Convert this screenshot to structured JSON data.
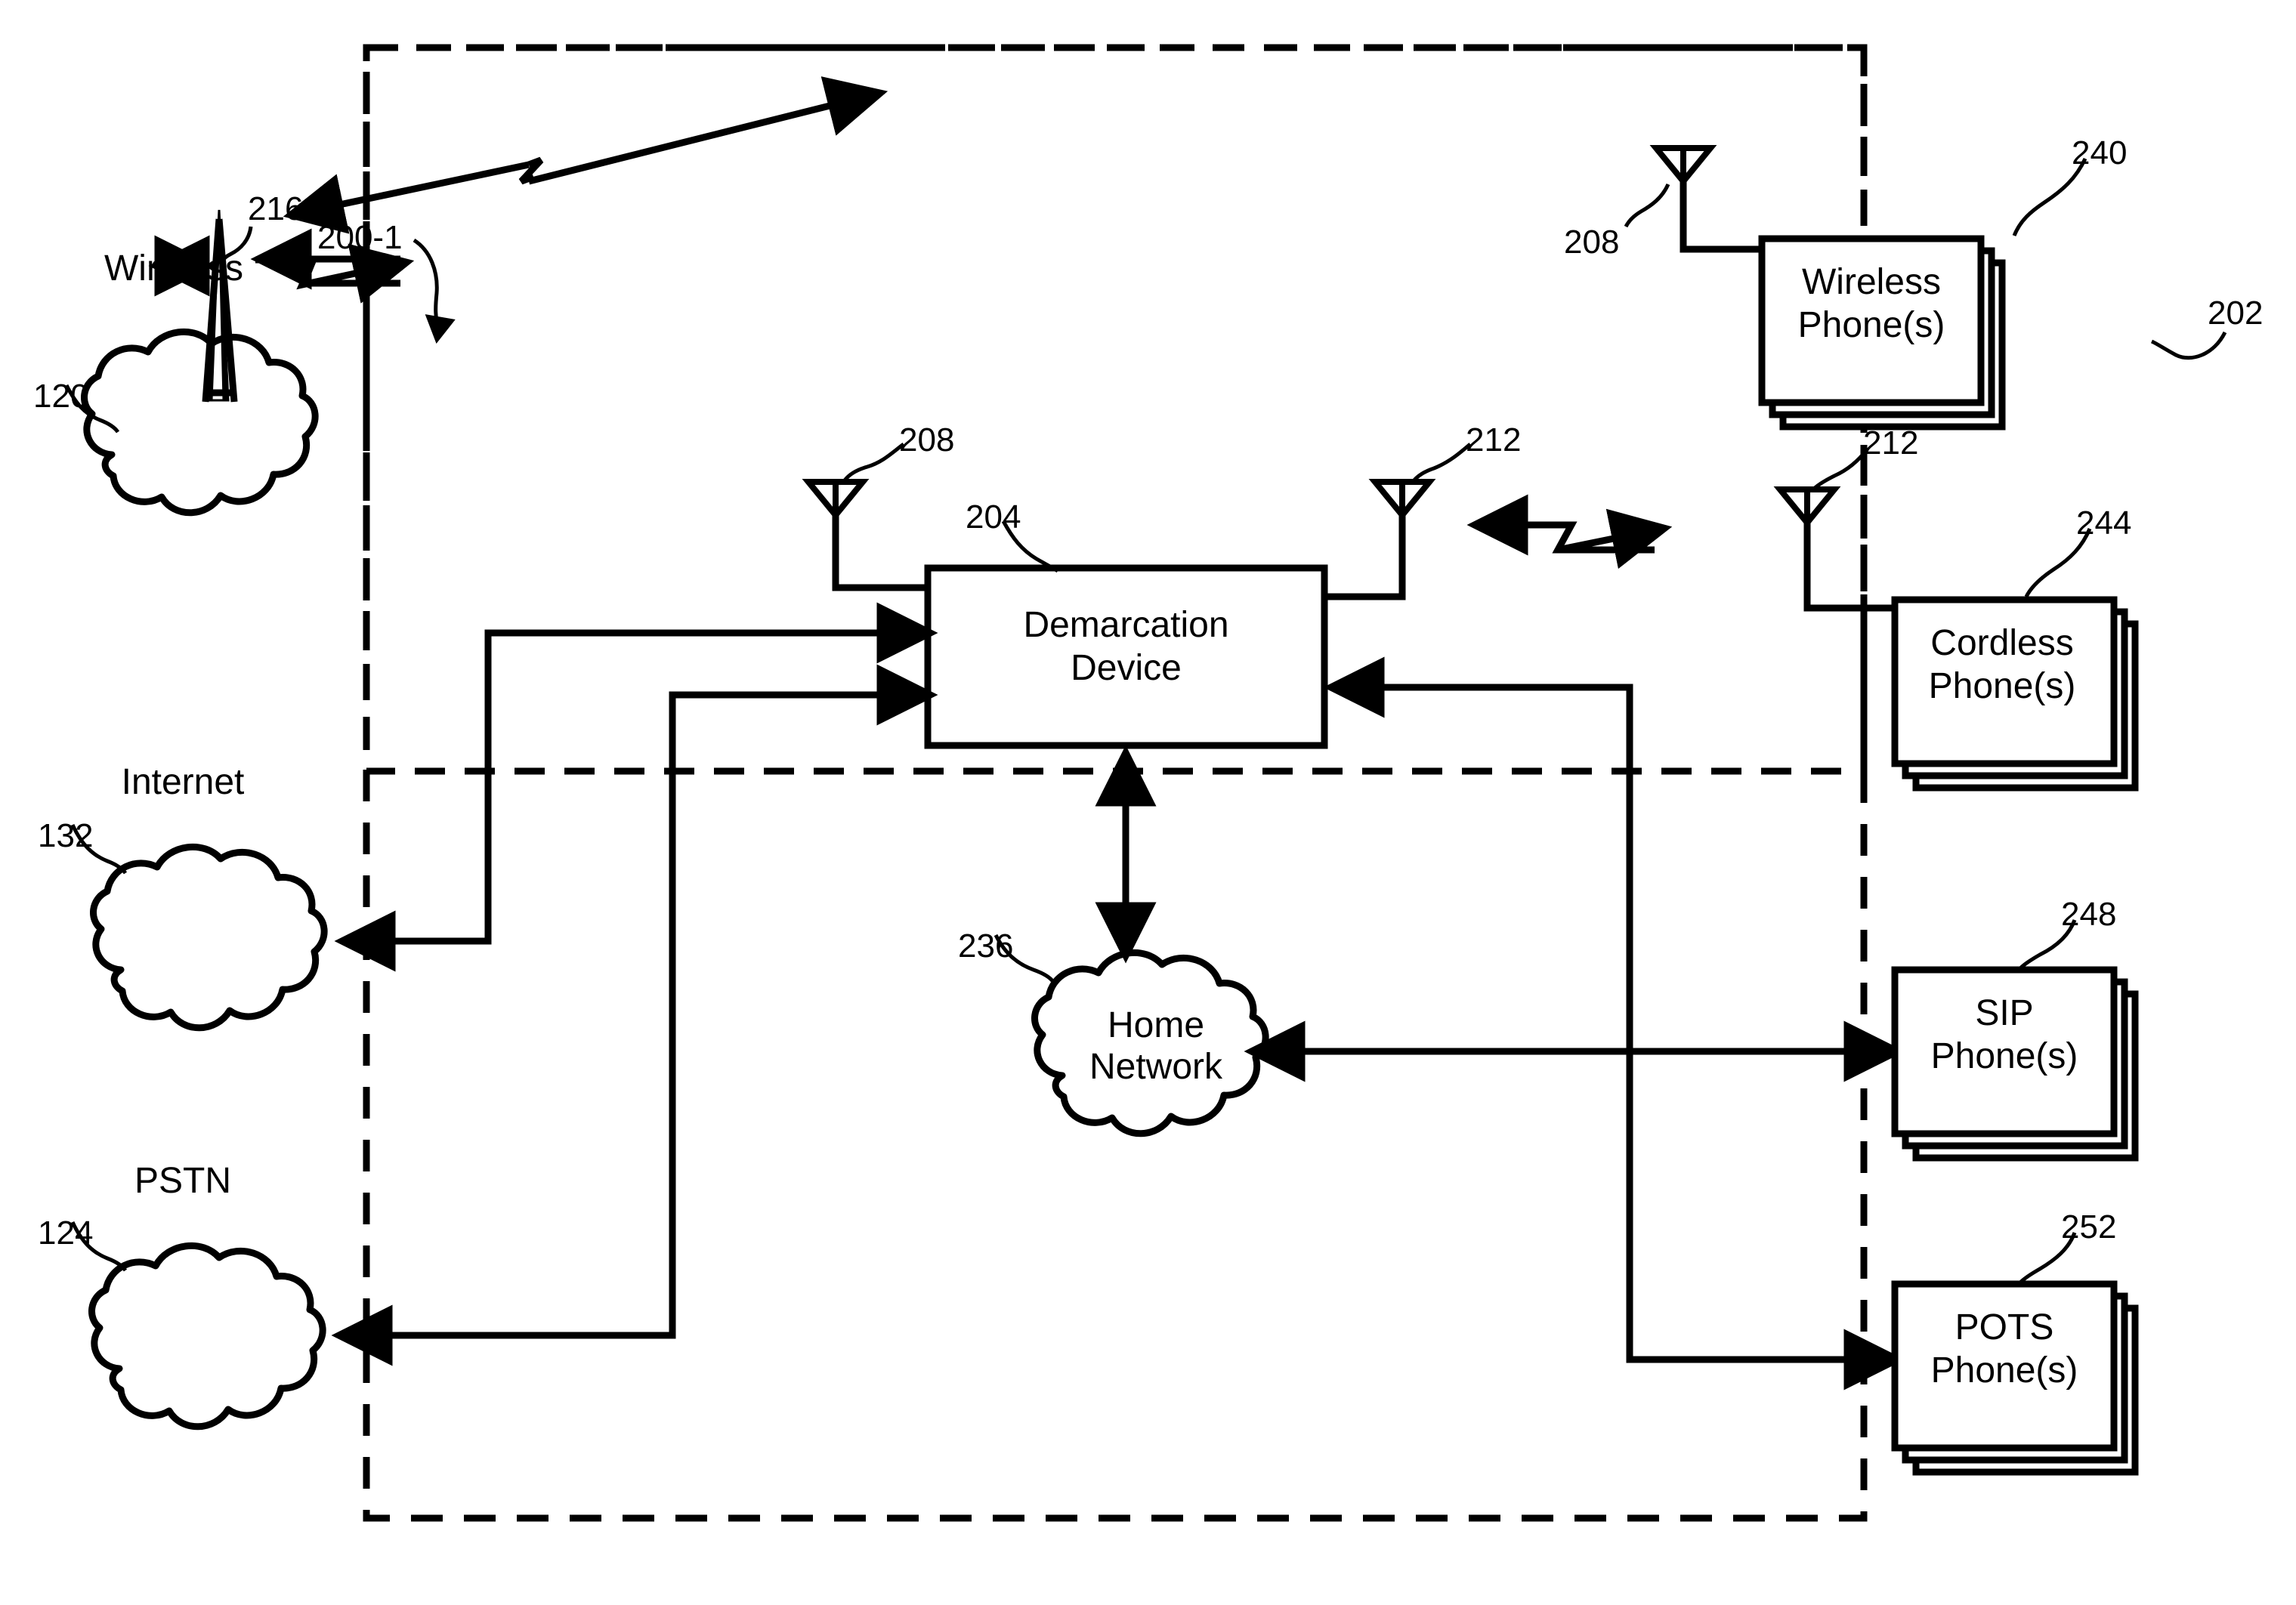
{
  "figure": {
    "diagram_label": "200-1",
    "boundary_label": "202"
  },
  "clouds": [
    {
      "name": "wireless-network-cloud",
      "text": "Wireless",
      "ref": "120"
    },
    {
      "name": "internet-cloud",
      "text": "Internet",
      "ref": "132"
    },
    {
      "name": "pstn-cloud",
      "text": "PSTN",
      "ref": "124"
    },
    {
      "name": "home-network-cloud",
      "text": "Home\nNetwork",
      "ref": "236"
    }
  ],
  "boxes": [
    {
      "name": "demarcation-device-box",
      "text": "Demarcation\nDevice",
      "ref": "204"
    },
    {
      "name": "wireless-phones-box",
      "text": "Wireless\nPhone(s)",
      "ref": "240"
    },
    {
      "name": "cordless-phones-box",
      "text": "Cordless\nPhone(s)",
      "ref": "244"
    },
    {
      "name": "sip-phones-box",
      "text": "SIP\nPhone(s)",
      "ref": "248"
    },
    {
      "name": "pots-phones-box",
      "text": "POTS\nPhone(s)",
      "ref": "252"
    }
  ],
  "antennas": [
    {
      "name": "antenna-demarc-cellular",
      "ref": "208"
    },
    {
      "name": "antenna-demarc-cordless",
      "ref": "212"
    },
    {
      "name": "antenna-cordless-phone",
      "ref": "212"
    },
    {
      "name": "antenna-wireless-phone",
      "ref": "208"
    }
  ],
  "tower": {
    "name": "cell-tower",
    "ref": "216"
  },
  "refs": {
    "r200_1": "200-1",
    "r202": "202",
    "r204": "204",
    "r208_demarc": "208",
    "r208_phone": "208",
    "r212_demarc": "212",
    "r212_phone": "212",
    "r216": "216",
    "r120": "120",
    "r124": "124",
    "r132": "132",
    "r236": "236",
    "r240": "240",
    "r244": "244",
    "r248": "248",
    "r252": "252"
  },
  "labels": {
    "wireless": "Wireless",
    "internet": "Internet",
    "pstn": "PSTN",
    "home_network": "Home\nNetwork",
    "demarcation_device": "Demarcation\nDevice",
    "wireless_phones": "Wireless\nPhone(s)",
    "cordless_phones": "Cordless\nPhone(s)",
    "sip_phones": "SIP\nPhone(s)",
    "pots_phones": "POTS\nPhone(s)"
  },
  "colors": {
    "stroke": "#000000",
    "background": "#ffffff"
  }
}
